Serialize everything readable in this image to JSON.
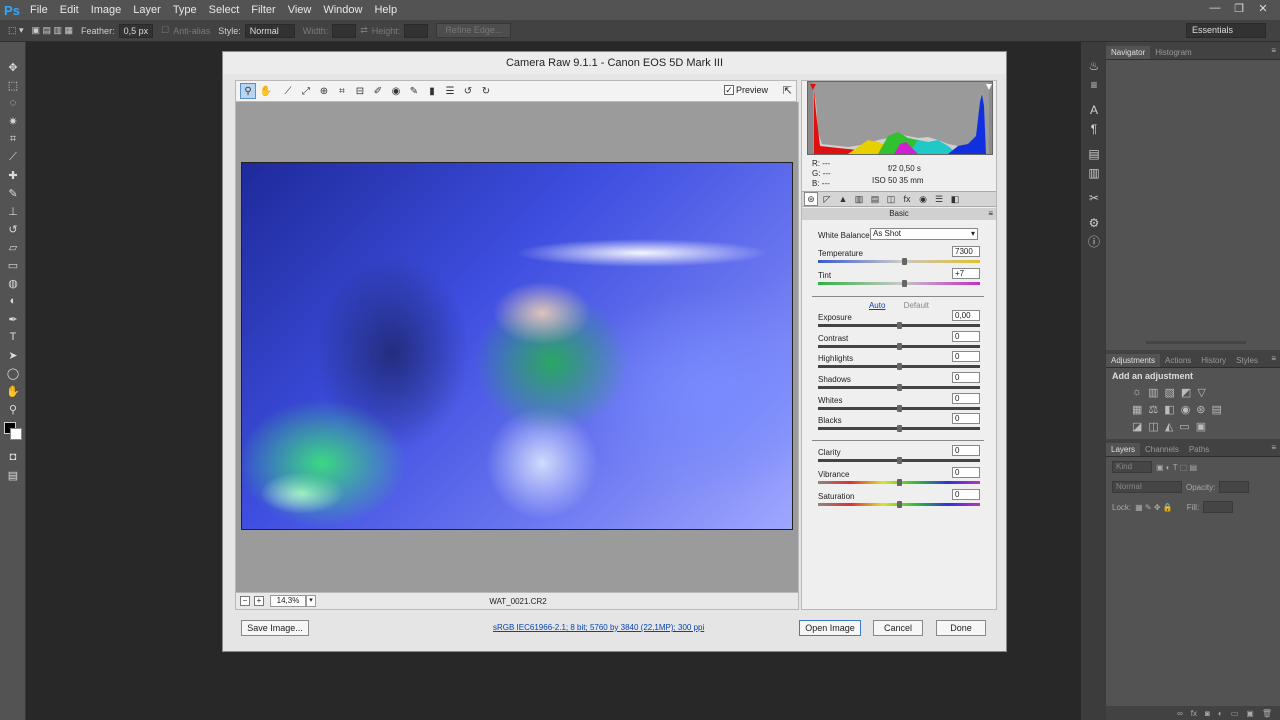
{
  "menubar": {
    "logo": "Ps",
    "items": [
      "File",
      "Edit",
      "Image",
      "Layer",
      "Type",
      "Select",
      "Filter",
      "View",
      "Window",
      "Help"
    ],
    "win_controls": [
      "—",
      "❐",
      "✕"
    ]
  },
  "options": {
    "feather_label": "Feather:",
    "feather_value": "0,5 px",
    "antialias": "Anti-alias",
    "style_label": "Style:",
    "style_value": "Normal",
    "width_label": "Width:",
    "height_label": "Height:",
    "refine_edge": "Refine Edge...",
    "workspace": "Essentials"
  },
  "panels": {
    "top_tabs": [
      "Navigator",
      "Histogram"
    ],
    "mid_tabs": [
      "Adjustments",
      "Actions",
      "History",
      "Styles"
    ],
    "add_adjustment": "Add an adjustment",
    "layer_tabs": [
      "Layers",
      "Channels",
      "Paths"
    ],
    "kind": "Kind",
    "blend": "Normal",
    "opacity_label": "Opacity:",
    "lock_label": "Lock:",
    "fill_label": "Fill:"
  },
  "dialog": {
    "title": "Camera Raw 9.1.1  -  Canon EOS 5D Mark III",
    "preview_label": "Preview",
    "zoom": "14,3%",
    "filename": "WAT_0021.CR2",
    "readout": {
      "r": "R:   ---",
      "g": "G:   ---",
      "b": "B:   ---",
      "aperture_shutter": "f/2   0,50 s",
      "iso_focal": "ISO 50   35 mm"
    },
    "panel_title": "Basic",
    "white_balance_label": "White Balance:",
    "white_balance_value": "As Shot",
    "auto": "Auto",
    "default": "Default",
    "controls": [
      {
        "label": "Temperature",
        "value": "7300",
        "pos": 0.53
      },
      {
        "label": "Tint",
        "value": "+7",
        "pos": 0.53
      },
      {
        "label": "Exposure",
        "value": "0,00",
        "pos": 0.5
      },
      {
        "label": "Contrast",
        "value": "0",
        "pos": 0.5
      },
      {
        "label": "Highlights",
        "value": "0",
        "pos": 0.5
      },
      {
        "label": "Shadows",
        "value": "0",
        "pos": 0.5
      },
      {
        "label": "Whites",
        "value": "0",
        "pos": 0.5
      },
      {
        "label": "Blacks",
        "value": "0",
        "pos": 0.5
      },
      {
        "label": "Clarity",
        "value": "0",
        "pos": 0.5
      },
      {
        "label": "Vibrance",
        "value": "0",
        "pos": 0.5
      },
      {
        "label": "Saturation",
        "value": "0",
        "pos": 0.5
      }
    ],
    "save_image": "Save Image...",
    "info_link": "sRGB IEC61966-2.1; 8 bit; 5760 by 3840 (22,1MP); 300 ppi",
    "open_image": "Open Image",
    "cancel": "Cancel",
    "done": "Done"
  }
}
